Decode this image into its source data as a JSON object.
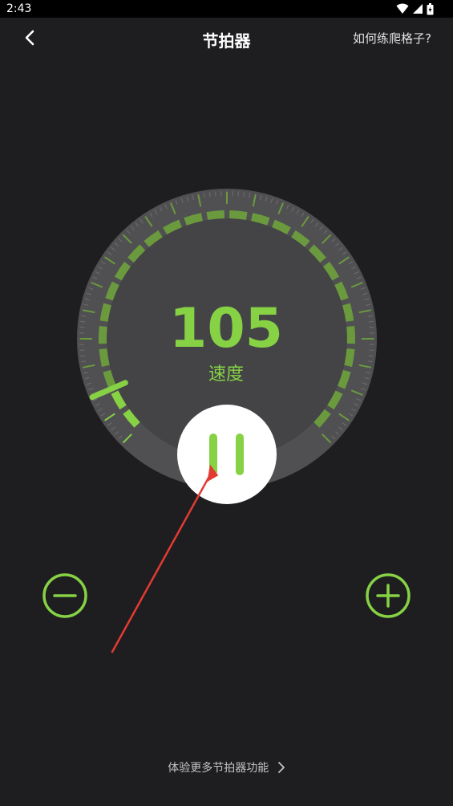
{
  "status_bar": {
    "time": "2:43",
    "icons": [
      "wifi-icon",
      "signal-icon",
      "battery-icon"
    ]
  },
  "app_bar": {
    "title": "节拍器",
    "help_link": "如何练爬格子?",
    "back_icon": "chevron-left-icon"
  },
  "metronome": {
    "tempo": "105",
    "tempo_label": "速度",
    "state": "playing",
    "play_pause_icon": "pause-icon",
    "decrease_icon": "minus-circle-icon",
    "increase_icon": "plus-circle-icon",
    "tempo_range_position": 0.08
  },
  "footer": {
    "more_link": "体验更多节拍器功能",
    "more_icon": "chevron-right-icon"
  },
  "colors": {
    "background": "#1e1e20",
    "dial_outer": "#505052",
    "dial_inner": "#444446",
    "accent": "#86d244",
    "accent_dim": "#6b9a3e",
    "annotation_arrow": "#e23b32"
  }
}
